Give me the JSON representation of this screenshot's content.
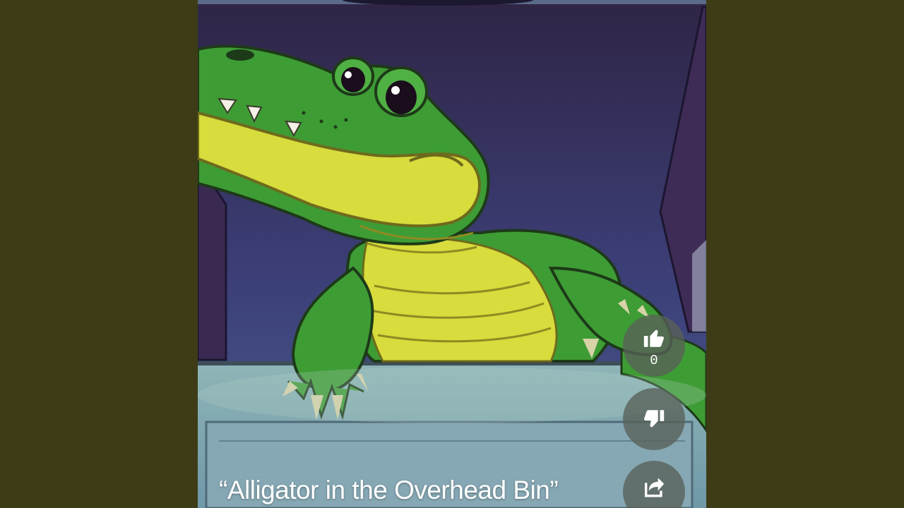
{
  "video": {
    "caption": "“Alligator in the Overhead Bin”"
  },
  "actions": {
    "like": {
      "icon": "thumbs-up-icon",
      "count": "0"
    },
    "dislike": {
      "icon": "thumbs-down-icon"
    },
    "share": {
      "icon": "share-icon"
    }
  },
  "colors": {
    "background": "#3d3c16",
    "bin_interior": "#3a2f55",
    "alligator_green": "#3e9c35",
    "alligator_belly": "#d8dc3c",
    "action_button": "#586058"
  }
}
